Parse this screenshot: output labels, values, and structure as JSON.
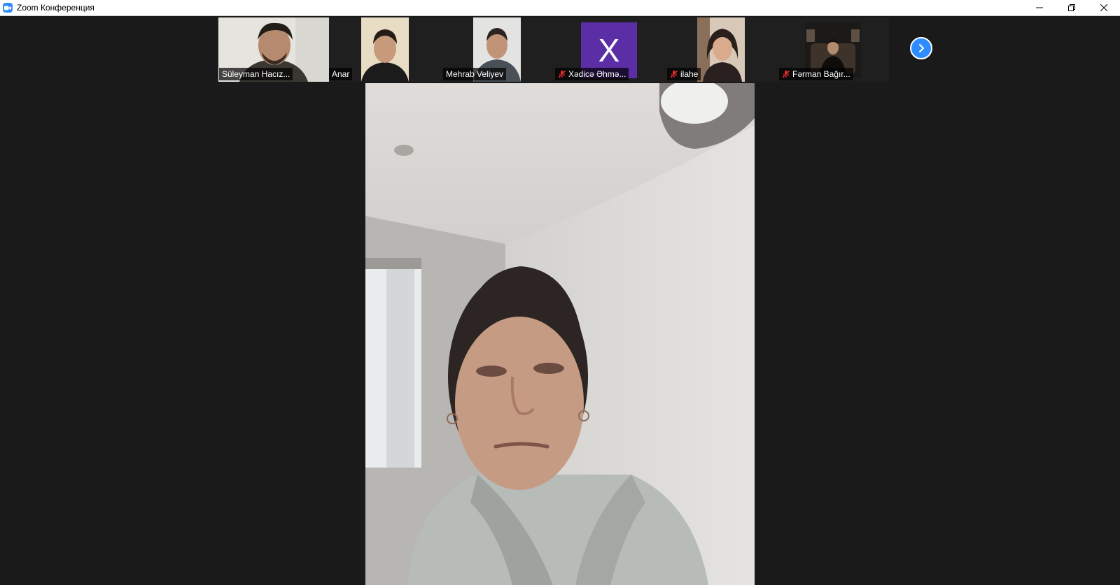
{
  "window": {
    "title": "Zoom Конференция",
    "icon": "zoom-camera-icon",
    "controls": [
      "minimize-icon",
      "restore-icon",
      "close-icon"
    ]
  },
  "participants": [
    {
      "name": "Süleyman Hacız...",
      "muted": false
    },
    {
      "name": "Anar",
      "muted": false
    },
    {
      "name": "Mehrab Veliyev",
      "muted": false
    },
    {
      "name": "Xədicə Əhmə...",
      "muted": true,
      "avatar_letter": "X",
      "avatar_color": "#5b2ea6"
    },
    {
      "name": "ilahe",
      "muted": true
    },
    {
      "name": "Fərman Bağır...",
      "muted": true
    }
  ],
  "gallery_nav": {
    "icon": "chevron-right-icon"
  },
  "active_speaker": {
    "icon": "speaker-video"
  },
  "colors": {
    "accent": "#2d8cff",
    "background": "#1a1a1a",
    "muted_icon": "#e02828"
  }
}
